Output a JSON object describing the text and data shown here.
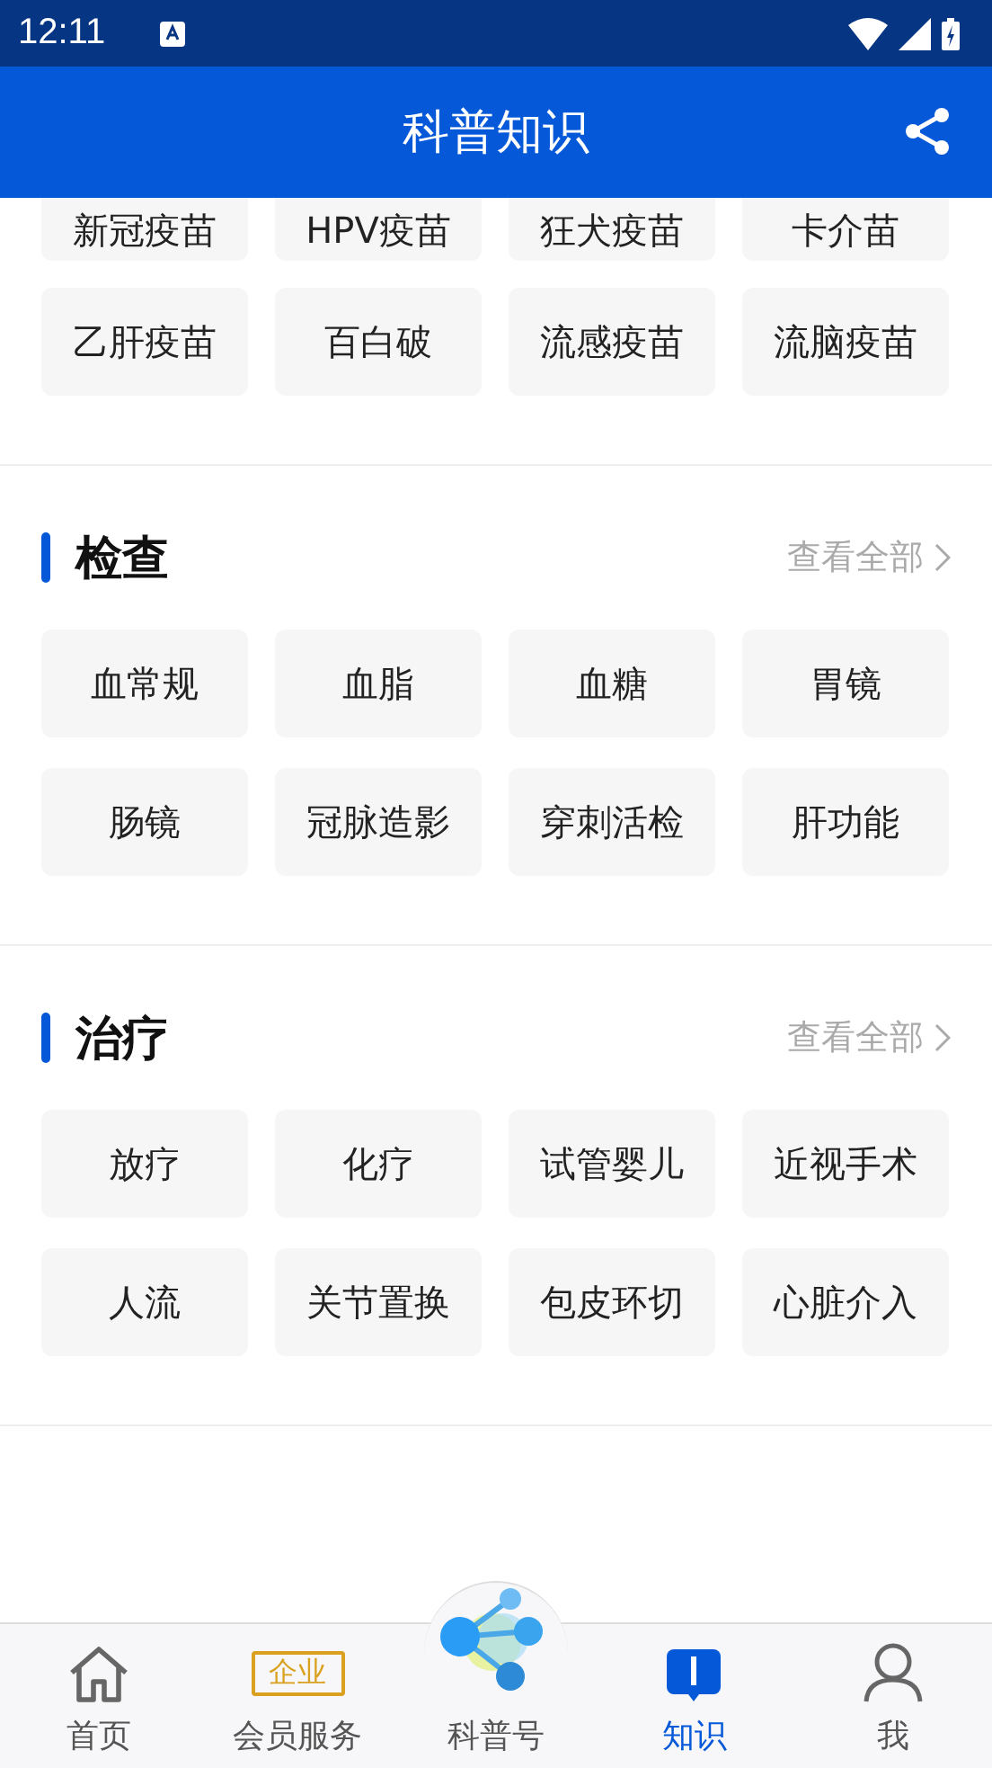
{
  "status_bar": {
    "time": "12:11"
  },
  "header": {
    "title": "科普知识"
  },
  "sections": [
    {
      "partial": true,
      "items": [
        "新冠疫苗",
        "HPV疫苗",
        "狂犬疫苗",
        "卡介苗",
        "乙肝疫苗",
        "百白破",
        "流感疫苗",
        "流脑疫苗"
      ]
    },
    {
      "partial": false,
      "title": "检查",
      "view_all": "查看全部",
      "items": [
        "血常规",
        "血脂",
        "血糖",
        "胃镜",
        "肠镜",
        "冠脉造影",
        "穿刺活检",
        "肝功能"
      ]
    },
    {
      "partial": false,
      "title": "治疗",
      "view_all": "查看全部",
      "items": [
        "放疗",
        "化疗",
        "试管婴儿",
        "近视手术",
        "人流",
        "关节置换",
        "包皮环切",
        "心脏介入"
      ]
    }
  ],
  "bottom_nav": [
    {
      "kind": "home",
      "label": "首页",
      "selected": false
    },
    {
      "kind": "badge",
      "badge": "企业",
      "label": "会员服务",
      "selected": false
    },
    {
      "kind": "center",
      "label": "科普号",
      "selected": false
    },
    {
      "kind": "book",
      "label": "知识",
      "selected": true
    },
    {
      "kind": "user",
      "label": "我",
      "selected": false
    }
  ]
}
